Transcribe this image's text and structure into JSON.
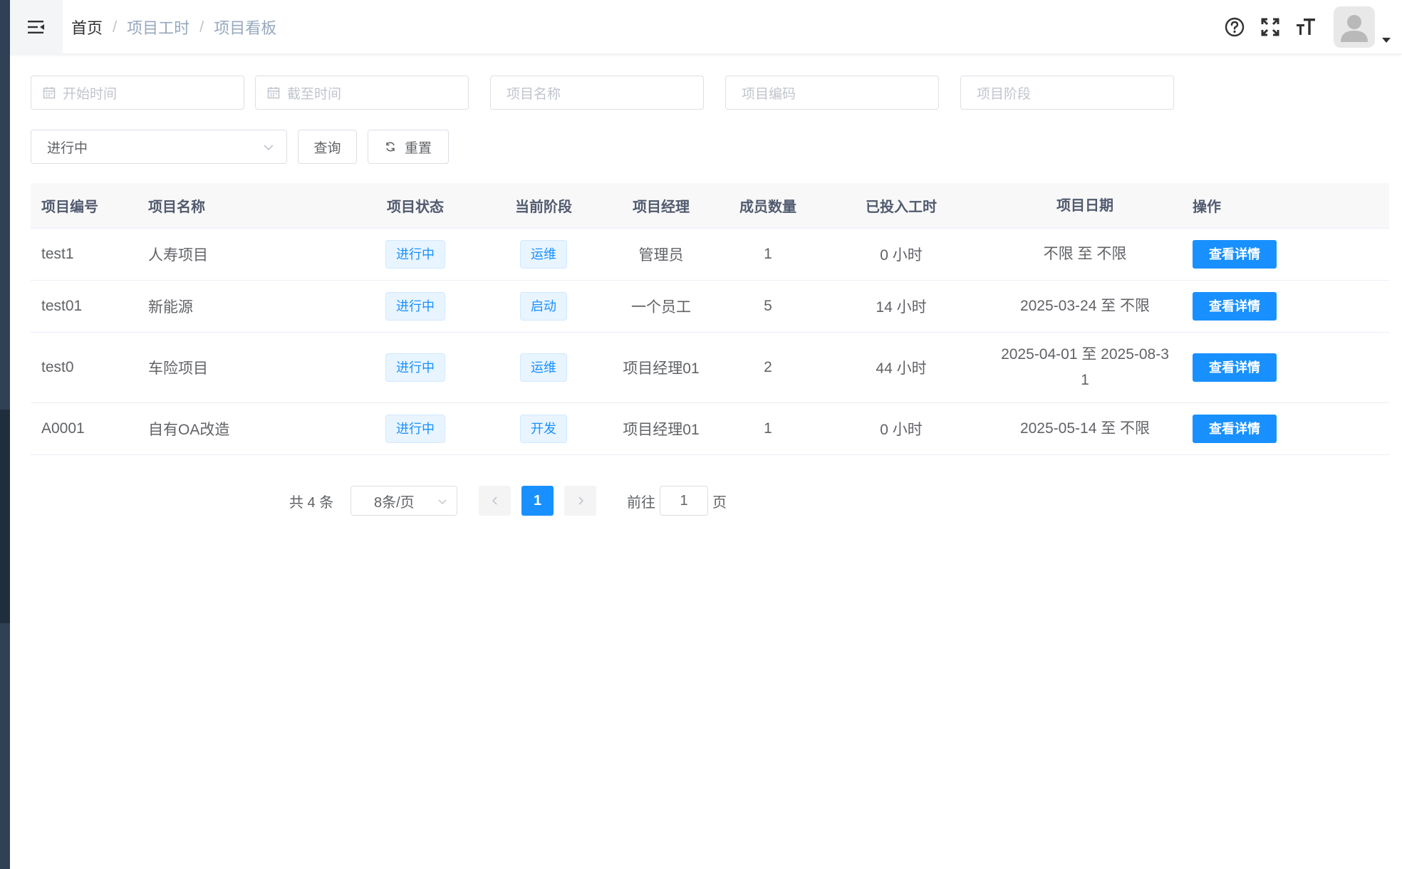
{
  "breadcrumb": [
    "首页",
    "项目工时",
    "项目看板"
  ],
  "navbar": {
    "icons": [
      "question-circle-icon",
      "fullscreen-icon",
      "font-size-icon"
    ],
    "avatar_icon": "user-avatar-icon"
  },
  "filters": {
    "start_time_placeholder": "开始时间",
    "end_time_placeholder": "截至时间",
    "project_name_placeholder": "项目名称",
    "project_code_placeholder": "项目编码",
    "project_stage_placeholder": "项目阶段",
    "status_value": "进行中",
    "query_label": "查询",
    "reset_label": "重置"
  },
  "table": {
    "headers": [
      "项目编号",
      "项目名称",
      "项目状态",
      "当前阶段",
      "项目经理",
      "成员数量",
      "已投入工时",
      "项目日期",
      "操作"
    ],
    "rows": [
      {
        "code": "test1",
        "name": "人寿项目",
        "status": "进行中",
        "stage": "运维",
        "manager": "管理员",
        "members": "1",
        "hours": "0 小时",
        "date": "不限 至 不限",
        "action": "查看详情"
      },
      {
        "code": "test01",
        "name": "新能源",
        "status": "进行中",
        "stage": "启动",
        "manager": "一个员工",
        "members": "5",
        "hours": "14 小时",
        "date": "2025-03-24 至 不限",
        "action": "查看详情"
      },
      {
        "code": "test0",
        "name": "车险项目",
        "status": "进行中",
        "stage": "运维",
        "manager": "项目经理01",
        "members": "2",
        "hours": "44 小时",
        "date": "2025-04-01 至 2025-08-31",
        "action": "查看详情"
      },
      {
        "code": "A0001",
        "name": "自有OA改造",
        "status": "进行中",
        "stage": "开发",
        "manager": "项目经理01",
        "members": "1",
        "hours": "0 小时",
        "date": "2025-05-14 至 不限",
        "action": "查看详情"
      }
    ]
  },
  "pagination": {
    "total_text": "共 4 条",
    "page_size": "8条/页",
    "current_page": "1",
    "goto_label": "前往",
    "goto_value": "1",
    "page_suffix": "页"
  },
  "colors": {
    "primary": "#1890ff",
    "tag_bg": "#e8f4ff",
    "sidebar": "#2f3a4c"
  }
}
